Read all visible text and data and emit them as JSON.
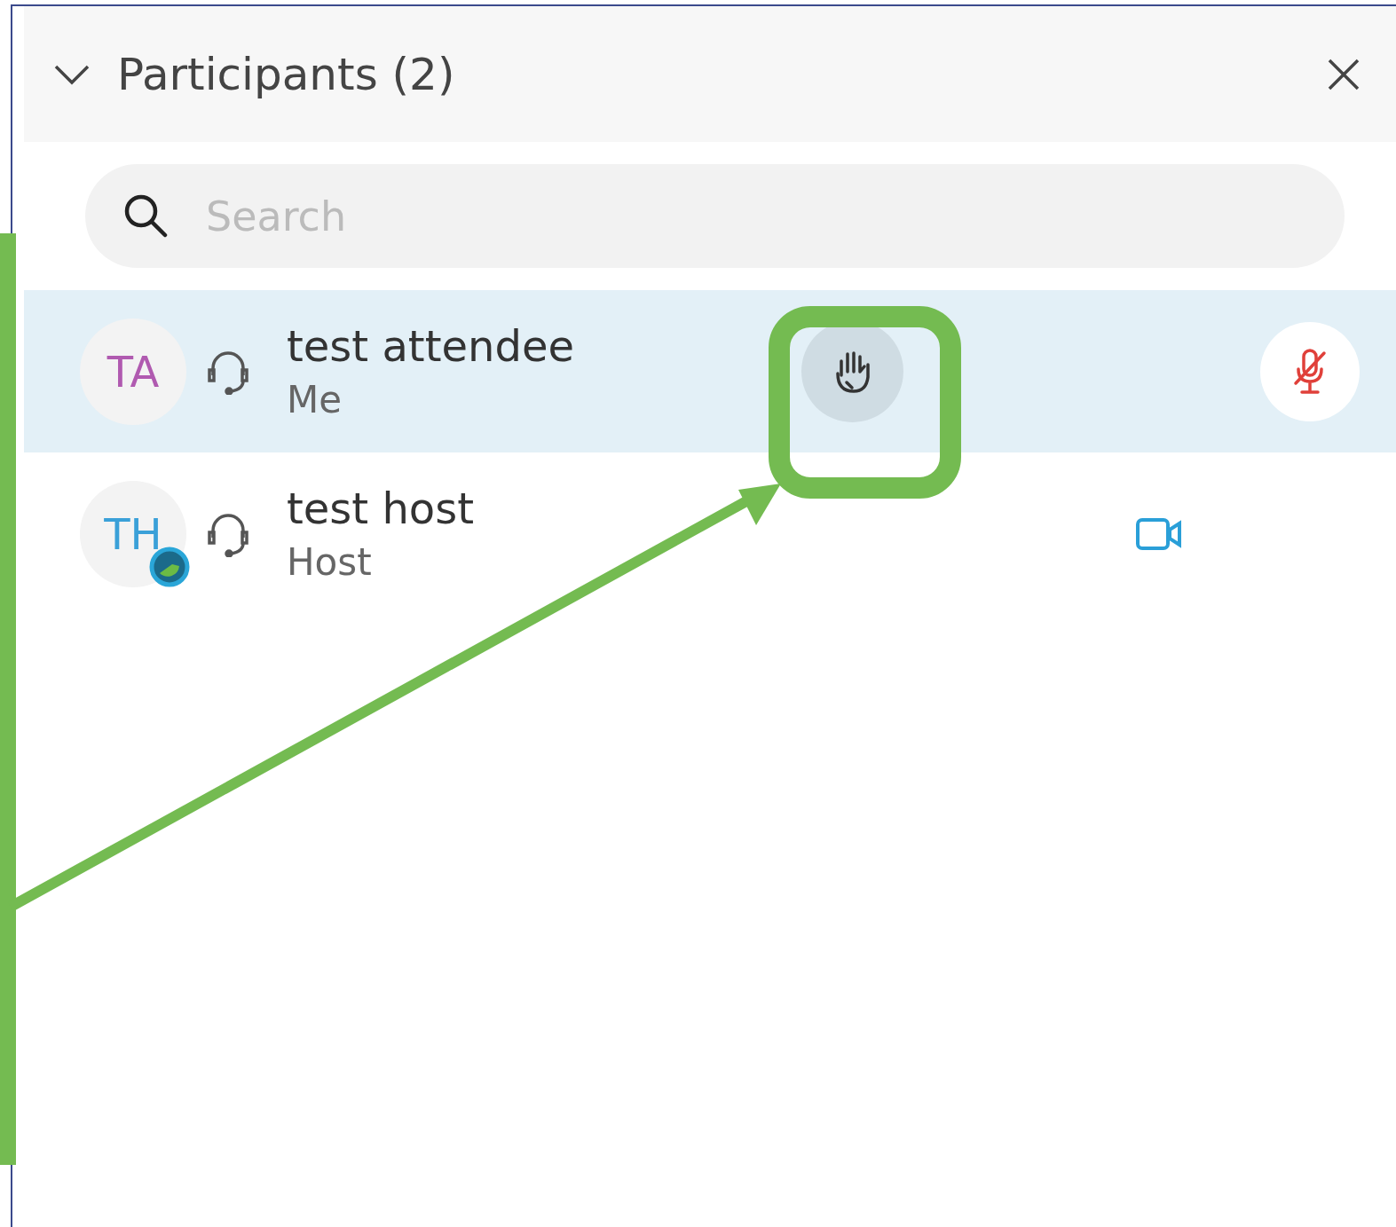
{
  "panel": {
    "title": "Participants (2)",
    "expanded": true
  },
  "search": {
    "placeholder": "Search"
  },
  "participants": [
    {
      "initials": "TA",
      "color": "#b05ab0",
      "name": "test attendee",
      "role": "Me",
      "selected": true,
      "host_badge": false,
      "hand_raised": true,
      "video": false,
      "muted": true
    },
    {
      "initials": "TH",
      "color": "#3aa0d8",
      "name": "test host",
      "role": "Host",
      "selected": false,
      "host_badge": true,
      "hand_raised": false,
      "video": true,
      "muted": false
    }
  ]
}
